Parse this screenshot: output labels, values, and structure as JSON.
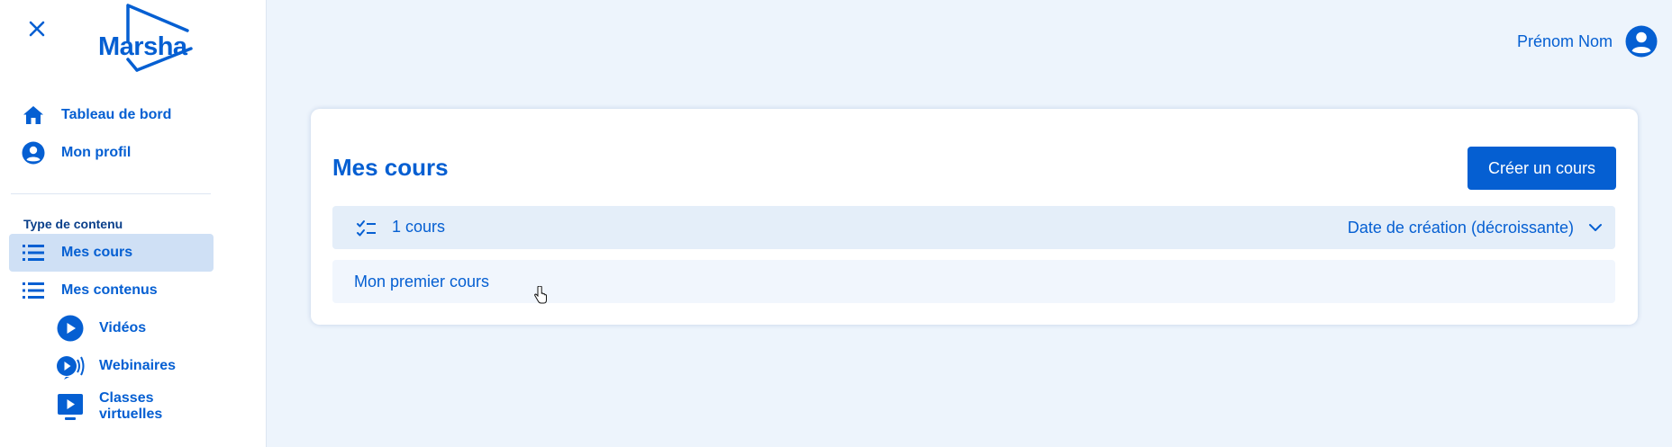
{
  "sidebar": {
    "logo_text": "Marsha",
    "items": [
      {
        "label": "Tableau de bord",
        "icon": "home-icon"
      },
      {
        "label": "Mon profil",
        "icon": "user-circle-icon"
      }
    ],
    "section_label": "Type de contenu",
    "content_items": [
      {
        "label": "Mes cours",
        "icon": "list-icon",
        "active": true
      },
      {
        "label": "Mes contenus",
        "icon": "list-icon"
      }
    ],
    "sub_items": [
      {
        "label": "Vidéos",
        "icon": "play-circle-icon"
      },
      {
        "label": "Webinaires",
        "icon": "broadcast-icon"
      },
      {
        "label_line1": "Classes",
        "label_line2": "virtuelles",
        "icon": "presentation-play-icon"
      }
    ]
  },
  "header": {
    "user_name": "Prénom Nom"
  },
  "main": {
    "title": "Mes cours",
    "create_button": "Créer un cours",
    "count_label": "1 cours",
    "sort_label": "Date de création (décroissante)",
    "courses": [
      {
        "title": "Mon premier cours"
      }
    ]
  },
  "colors": {
    "accent": "#055fd2",
    "background": "#edf4fc",
    "active_item": "#cfe0f5"
  }
}
